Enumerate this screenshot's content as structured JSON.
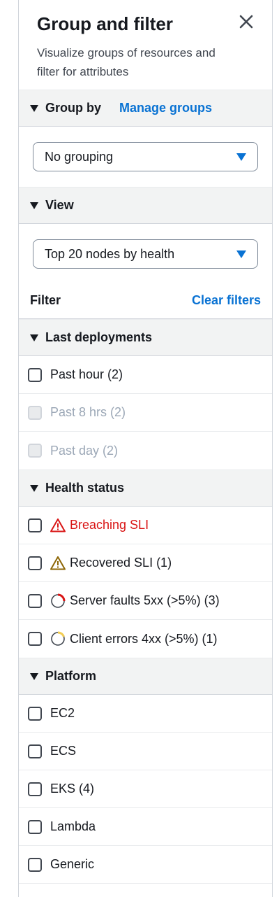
{
  "header": {
    "title": "Group and filter",
    "description": "Visualize groups of resources and filter for attributes"
  },
  "group_by": {
    "label": "Group by",
    "manage_link": "Manage groups",
    "selected": "No grouping"
  },
  "view": {
    "label": "View",
    "selected": "Top 20 nodes by health"
  },
  "filter": {
    "label": "Filter",
    "clear_link": "Clear filters"
  },
  "last_deployments": {
    "label": "Last deployments",
    "items": [
      {
        "label": "Past hour (2)",
        "disabled": false
      },
      {
        "label": "Past 8 hrs (2)",
        "disabled": true
      },
      {
        "label": "Past day (2)",
        "disabled": true
      }
    ]
  },
  "health_status": {
    "label": "Health status",
    "items": [
      {
        "label": "Breaching SLI",
        "icon": "warning-red-icon",
        "color": "#d91515"
      },
      {
        "label": "Recovered SLI (1)",
        "icon": "warning-amber-icon",
        "color": "#8d6605"
      },
      {
        "label": "Server faults 5xx  (>5%) (3)",
        "icon": "server-faults-ring-icon",
        "color": "#d91515"
      },
      {
        "label": "Client errors 4xx  (>5%) (1)",
        "icon": "client-errors-ring-icon",
        "color": "#f2cd54"
      }
    ]
  },
  "platform": {
    "label": "Platform",
    "items": [
      {
        "label": "EC2"
      },
      {
        "label": "ECS"
      },
      {
        "label": "EKS (4)"
      },
      {
        "label": "Lambda"
      },
      {
        "label": "Generic"
      }
    ]
  }
}
